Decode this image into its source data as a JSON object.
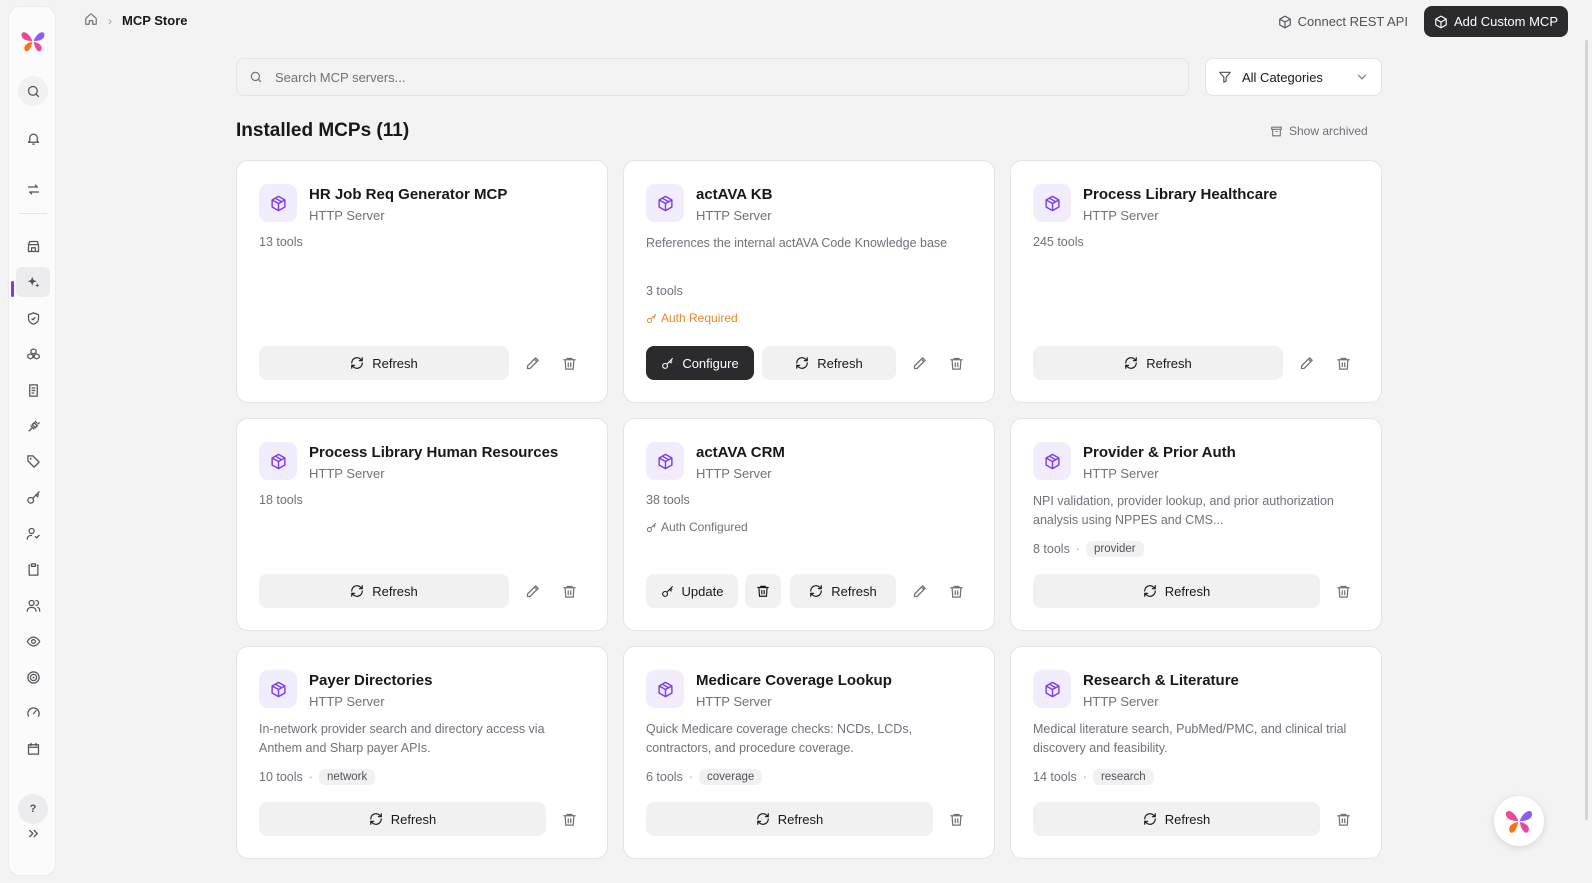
{
  "breadcrumb": {
    "current": "MCP Store"
  },
  "header": {
    "connect_label": "Connect REST API",
    "add_label": "Add Custom MCP"
  },
  "search": {
    "placeholder": "Search MCP servers..."
  },
  "filter": {
    "selected": "All Categories"
  },
  "section": {
    "title": "Installed MCPs (11)",
    "show_archived": "Show archived"
  },
  "sidebar": {
    "help": "?"
  },
  "labels": {
    "refresh": "Refresh",
    "configure": "Configure",
    "update": "Update"
  },
  "cards": [
    {
      "title": "HR Job Req Generator MCP",
      "subtitle": "HTTP Server",
      "tools": "13 tools"
    },
    {
      "title": "actAVA KB",
      "subtitle": "HTTP Server",
      "description": "References the internal actAVA Code Knowledge base",
      "tools": "3 tools",
      "auth": "Auth Required"
    },
    {
      "title": "Process Library Healthcare",
      "subtitle": "HTTP Server",
      "tools": "245 tools"
    },
    {
      "title": "Process Library Human Resources",
      "subtitle": "HTTP Server",
      "tools": "18 tools"
    },
    {
      "title": "actAVA CRM",
      "subtitle": "HTTP Server",
      "tools": "38 tools",
      "auth": "Auth Configured"
    },
    {
      "title": "Provider & Prior Auth",
      "subtitle": "HTTP Server",
      "description": "NPI validation, provider lookup, and prior authorization analysis using NPPES and CMS...",
      "tools": "8 tools",
      "tag": "provider"
    },
    {
      "title": "Payer Directories",
      "subtitle": "HTTP Server",
      "description": "In-network provider search and directory access via Anthem and Sharp payer APIs.",
      "tools": "10 tools",
      "tag": "network"
    },
    {
      "title": "Medicare Coverage Lookup",
      "subtitle": "HTTP Server",
      "description": "Quick Medicare coverage checks: NCDs, LCDs, contractors, and procedure coverage.",
      "tools": "6 tools",
      "tag": "coverage"
    },
    {
      "title": "Research & Literature",
      "subtitle": "HTTP Server",
      "description": "Medical literature search, PubMed/PMC, and clinical trial discovery and feasibility.",
      "tools": "14 tools",
      "tag": "research"
    }
  ],
  "colors": {
    "accent": "#7c3aed",
    "dark_button": "#2b2b2e",
    "auth_required": "#e8862a"
  }
}
